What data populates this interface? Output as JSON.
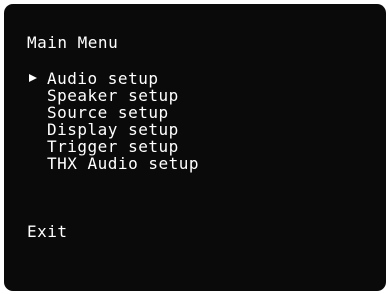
{
  "screen": {
    "background": "#0a0a0a",
    "text_color": "#ffffff",
    "page_background": "#ffffff"
  },
  "menu": {
    "title": "Main Menu",
    "selected_index": 0,
    "cursor_icon": "triangle-right-icon",
    "items": [
      {
        "label": "Audio setup"
      },
      {
        "label": "Speaker setup"
      },
      {
        "label": "Source setup"
      },
      {
        "label": "Display setup"
      },
      {
        "label": "Trigger setup"
      },
      {
        "label": "THX Audio setup"
      }
    ],
    "exit_label": "Exit"
  }
}
